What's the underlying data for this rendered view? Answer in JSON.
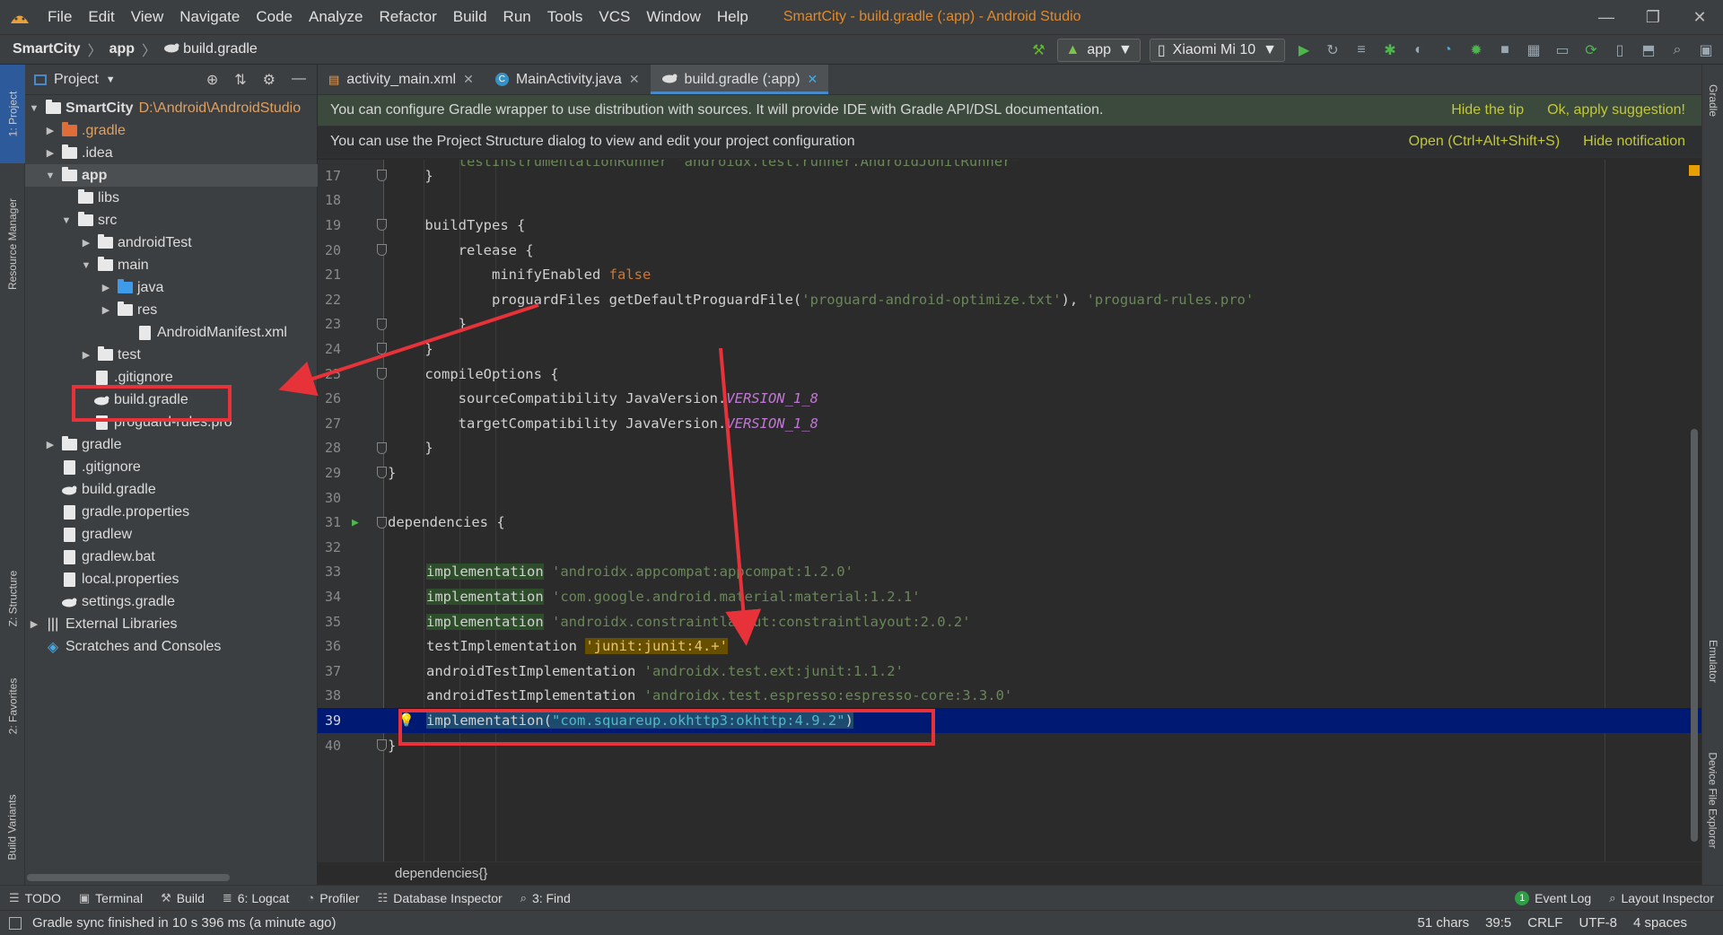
{
  "menu": {
    "items": [
      "File",
      "Edit",
      "View",
      "Navigate",
      "Code",
      "Analyze",
      "Refactor",
      "Build",
      "Run",
      "Tools",
      "VCS",
      "Window",
      "Help"
    ],
    "title": "SmartCity - build.gradle (:app) - Android Studio"
  },
  "navbar": {
    "crumbs": [
      "SmartCity",
      "app",
      "build.gradle"
    ],
    "run_config": "app",
    "device": "Xiaomi Mi 10"
  },
  "left_tabs": [
    "1: Project",
    "Resource Manager",
    "Z: Structure",
    "2: Favorites",
    "Build Variants"
  ],
  "right_tabs": [
    "Gradle",
    "Emulator",
    "Device File Explorer"
  ],
  "project": {
    "view_label": "Project",
    "tree": [
      {
        "label": "SmartCity",
        "path": "D:\\Android\\AndroidStudio"
      },
      {
        "label": ".gradle"
      },
      {
        "label": ".idea"
      },
      {
        "label": "app"
      },
      {
        "label": "libs"
      },
      {
        "label": "src"
      },
      {
        "label": "androidTest"
      },
      {
        "label": "main"
      },
      {
        "label": "java"
      },
      {
        "label": "res"
      },
      {
        "label": "AndroidManifest.xml"
      },
      {
        "label": "test"
      },
      {
        "label": ".gitignore"
      },
      {
        "label": "build.gradle"
      },
      {
        "label": "proguard-rules.pro"
      },
      {
        "label": "gradle"
      },
      {
        "label": ".gitignore"
      },
      {
        "label": "build.gradle"
      },
      {
        "label": "gradle.properties"
      },
      {
        "label": "gradlew"
      },
      {
        "label": "gradlew.bat"
      },
      {
        "label": "local.properties"
      },
      {
        "label": "settings.gradle"
      },
      {
        "label": "External Libraries"
      },
      {
        "label": "Scratches and Consoles"
      }
    ]
  },
  "editor": {
    "tabs": [
      "activity_main.xml",
      "MainActivity.java",
      "build.gradle (:app)"
    ],
    "banner1": {
      "text": "You can configure Gradle wrapper to use distribution with sources. It will provide IDE with Gradle API/DSL documentation.",
      "link1": "Hide the tip",
      "link2": "Ok, apply suggestion!"
    },
    "banner2": {
      "text": "You can use the Project Structure dialog to view and edit your project configuration",
      "link1": "Open (Ctrl+Alt+Shift+S)",
      "link2": "Hide notification"
    },
    "line_numbers": [
      "17",
      "18",
      "19",
      "20",
      "21",
      "22",
      "23",
      "24",
      "25",
      "26",
      "27",
      "28",
      "29",
      "30",
      "31",
      "32",
      "33",
      "34",
      "35",
      "36",
      "37",
      "38",
      "39",
      "40"
    ],
    "lines": {
      "l17": "    }",
      "l19": "    buildTypes {",
      "l20": "        release {",
      "l21a": "            minifyEnabled ",
      "l21b": "false",
      "l22a": "            proguardFiles getDefaultProguardFile(",
      "l22b": "'proguard-android-optimize.txt'",
      "l22c": "), ",
      "l22d": "'proguard-rules.pro'",
      "l23": "        }",
      "l24": "    }",
      "l25": "    compileOptions {",
      "l26a": "        sourceCompatibility JavaVersion.",
      "l26b": "VERSION_1_8",
      "l27a": "        targetCompatibility JavaVersion.",
      "l27b": "VERSION_1_8",
      "l28": "    }",
      "l29": "}",
      "l31": "dependencies {",
      "l33a": "implementation",
      "l33b": "'androidx.appcompat:appcompat:1.2.0'",
      "l34a": "implementation",
      "l34b": "'com.google.android.material:material:1.2.1'",
      "l35a": "implementation",
      "l35b": "'androidx.constraintlayout:constraintlayout:2.0.2'",
      "l36a": "testImplementation ",
      "l36b": "'junit:junit:4.+'",
      "l37a": "androidTestImplementation ",
      "l37b": "'androidx.test.ext:junit:1.1.2'",
      "l38a": "androidTestImplementation ",
      "l38b": "'androidx.test.espresso:espresso-core:3.3.0'",
      "l39a": "implementation(",
      "l39b": "\"com.squareup.okhttp3:okhttp:4.9.2\"",
      "l39c": ")",
      "l40": "}"
    },
    "breadcrumb": "dependencies{}"
  },
  "bottom_tools": {
    "left": [
      {
        "icon": "list-icon",
        "label": "TODO"
      },
      {
        "icon": "terminal-icon",
        "label": "Terminal"
      },
      {
        "icon": "hammer-icon",
        "label": "Build"
      },
      {
        "icon": "logcat-icon",
        "label": "6: Logcat"
      },
      {
        "icon": "profiler-icon",
        "label": "Profiler"
      },
      {
        "icon": "database-icon",
        "label": "Database Inspector"
      },
      {
        "icon": "search-icon",
        "label": "3: Find"
      }
    ],
    "right": [
      {
        "icon": "event-log-icon",
        "label": "Event Log",
        "badge": "1"
      },
      {
        "icon": "layout-inspector-icon",
        "label": "Layout Inspector"
      }
    ]
  },
  "status": {
    "message": "Gradle sync finished in 10 s 396 ms (a minute ago)",
    "chars": "51 chars",
    "position": "39:5",
    "line_sep": "CRLF",
    "encoding": "UTF-8",
    "indent": "4 spaces"
  },
  "colors": {
    "annotation": "#e8323a",
    "accent": "#4a88c7",
    "title": "#e08a2c"
  }
}
